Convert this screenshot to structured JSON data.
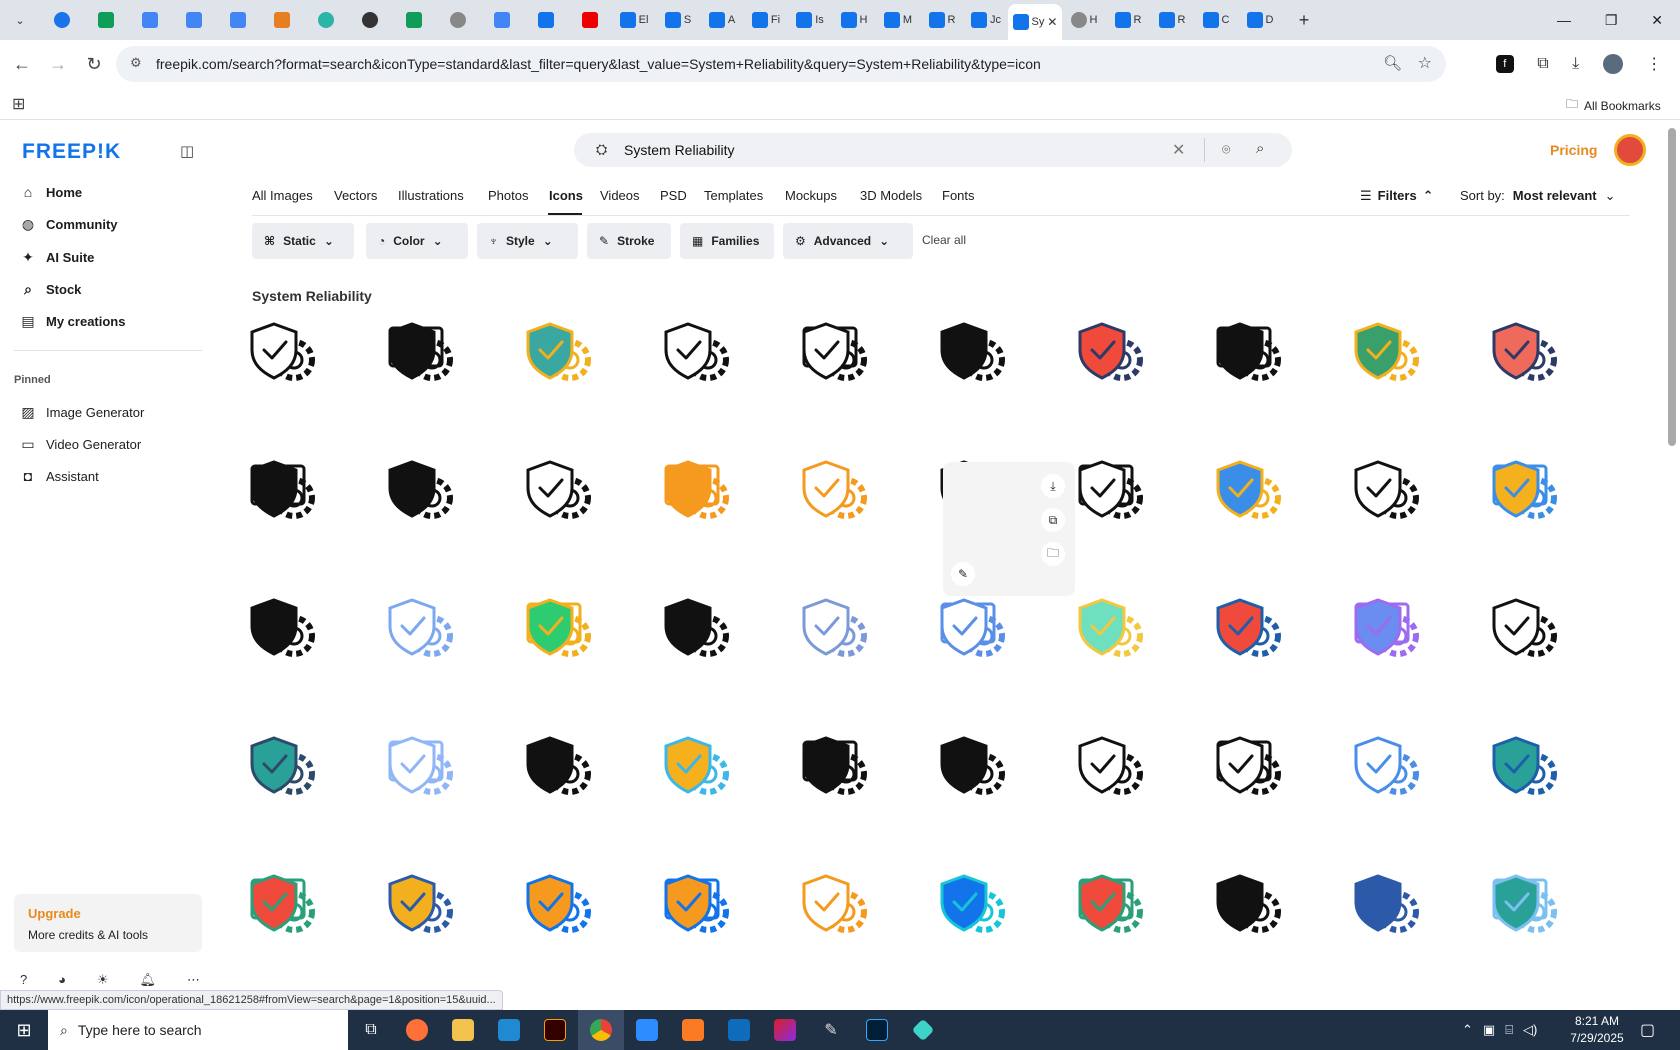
{
  "browser": {
    "url": "freepik.com/search?format=search&iconType=standard&last_filter=query&last_value=System+Reliability&query=System+Reliability&type=icon",
    "bookmarks_label": "All Bookmarks",
    "tabs": [
      "El",
      "S",
      "A",
      "Fi",
      "Is",
      "H",
      "M",
      "R",
      "Jc",
      "Sy",
      "H",
      "R",
      "R",
      "C",
      "D"
    ],
    "status_url": "https://www.freepik.com/icon/operational_18621258#fromView=search&page=1&position=15&uuid..."
  },
  "site": {
    "logo": "FREEP!K",
    "pricing": "Pricing",
    "search_value": "System Reliability"
  },
  "sidebar": {
    "items": [
      "Home",
      "Community",
      "AI Suite",
      "Stock",
      "My creations"
    ],
    "pinned_label": "Pinned",
    "pinned": [
      "Image Generator",
      "Video Generator",
      "Assistant"
    ],
    "upgrade_title": "Upgrade",
    "upgrade_sub": "More credits & AI tools"
  },
  "categories": [
    "All Images",
    "Vectors",
    "Illustrations",
    "Photos",
    "Icons",
    "Videos",
    "PSD",
    "Templates",
    "Mockups",
    "3D Models",
    "Fonts"
  ],
  "active_category": "Icons",
  "filters_label": "Filters",
  "sort_label": "Sort by:",
  "sort_value": "Most relevant",
  "chips": [
    "Static",
    "Color",
    "Style",
    "Stroke",
    "Families",
    "Advanced"
  ],
  "clear_all": "Clear all",
  "results_title": "System Reliability",
  "colors": {
    "accent": "#1273eb",
    "pricing": "#e78a1f",
    "upgrade": "#e78a1f",
    "taskbar": "#1f2f44"
  },
  "taskbar": {
    "search_placeholder": "Type here to search",
    "time": "8:21 AM",
    "date": "7/29/2025"
  }
}
